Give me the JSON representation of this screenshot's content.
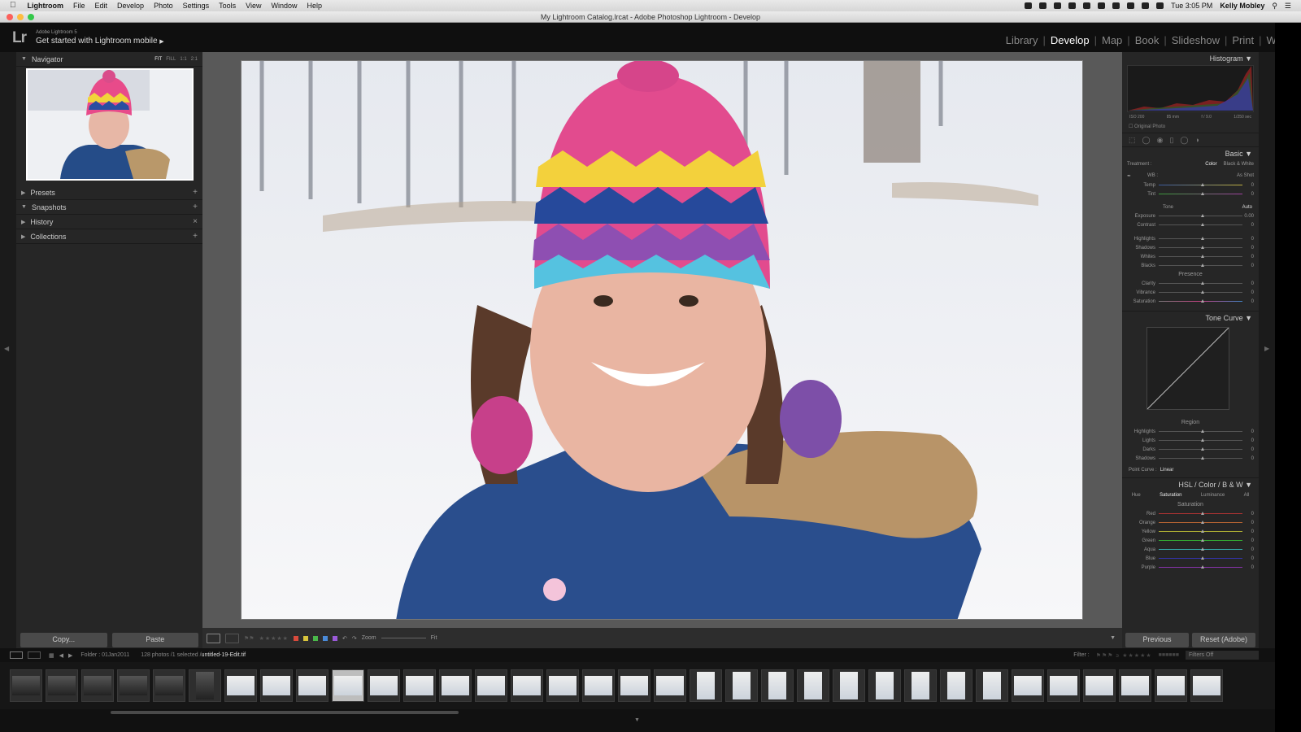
{
  "menubar": {
    "apple": "",
    "app": "Lightroom",
    "items": [
      "File",
      "Edit",
      "Develop",
      "Photo",
      "Settings",
      "Tools",
      "View",
      "Window",
      "Help"
    ],
    "clock": "Tue 3:05 PM",
    "user": "Kelly Mobley"
  },
  "window": {
    "title": "My Lightroom Catalog.lrcat - Adobe Photoshop Lightroom - Develop"
  },
  "identity": {
    "logo": "Lr",
    "product": "Adobe Lightroom 5",
    "mobile": "Get started with Lightroom mobile"
  },
  "modules": [
    "Library",
    "Develop",
    "Map",
    "Book",
    "Slideshow",
    "Print",
    "Web"
  ],
  "left": {
    "navigator": "Navigator",
    "nav_modes": [
      "FIT",
      "FILL",
      "1:1",
      "2:1"
    ],
    "presets": "Presets",
    "snapshots": "Snapshots",
    "history": "History",
    "collections": "Collections",
    "copy": "Copy...",
    "paste": "Paste"
  },
  "toolbar": {
    "zoom": "Zoom",
    "fit": "Fit"
  },
  "right": {
    "histogram": "Histogram",
    "exif": [
      "ISO 200",
      "85 mm",
      "f / 9.0",
      "1/250 sec"
    ],
    "original_photo": "Original Photo",
    "basic": "Basic",
    "treatment": "Treatment :",
    "color": "Color",
    "bw": "Black & White",
    "wb": "WB :",
    "as_shot": "As Shot",
    "temp": "Temp",
    "tint": "Tint",
    "tone": "Tone",
    "auto": "Auto",
    "exposure": "Exposure",
    "exposure_val": "0.00",
    "contrast": "Contrast",
    "highlights": "Highlights",
    "shadows": "Shadows",
    "whites": "Whites",
    "blacks": "Blacks",
    "presence": "Presence",
    "clarity": "Clarity",
    "vibrance": "Vibrance",
    "saturation": "Saturation",
    "tone_curve": "Tone Curve",
    "region": "Region",
    "lights": "Lights",
    "darks": "Darks",
    "point_curve": "Point Curve :",
    "linear": "Linear",
    "hsl": "HSL",
    "hsl_color": "Color",
    "hsl_bw": "B & W",
    "hue": "Hue",
    "sat_tab": "Saturation",
    "lum": "Luminance",
    "all": "All",
    "sat_head": "Saturation",
    "colors": [
      "Red",
      "Orange",
      "Yellow",
      "Green",
      "Aqua",
      "Blue",
      "Purple"
    ],
    "zero": "0",
    "previous": "Previous",
    "reset": "Reset (Adobe)"
  },
  "filmbar": {
    "folder": "Folder : 01Jan2011",
    "count": "128 photos /1 selected /",
    "file": "untitled-19-Edit.tif",
    "filter": "Filter :",
    "filters_off": "Filters Off"
  },
  "label_colors": [
    "#d84a3c",
    "#d8c43c",
    "#4ab84a",
    "#4a8ad8",
    "#9a5ad8"
  ]
}
